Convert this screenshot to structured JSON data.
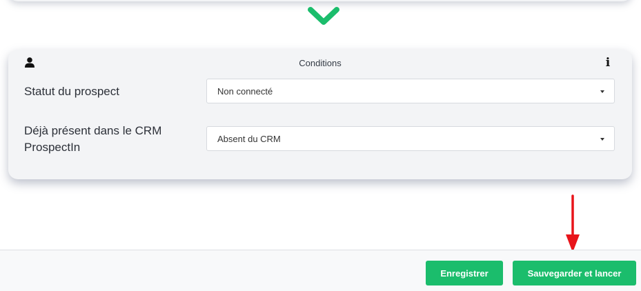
{
  "conditions": {
    "title": "Conditions",
    "fields": [
      {
        "label": "Statut du prospect",
        "value": "Non connecté"
      },
      {
        "label": "Déjà présent dans le CRM ProspectIn",
        "value": "Absent du CRM"
      }
    ]
  },
  "footer": {
    "save_label": "Enregistrer",
    "save_launch_label": "Sauvegarder et lancer"
  },
  "icons": {
    "header_left": "user-icon",
    "header_right": "info-icon",
    "connector": "chevron-down-icon",
    "annotation": "arrow-down-icon"
  },
  "colors": {
    "accent": "#1bbd6c",
    "annotation": "#e8141a",
    "card_background": "#f3f4f6"
  }
}
